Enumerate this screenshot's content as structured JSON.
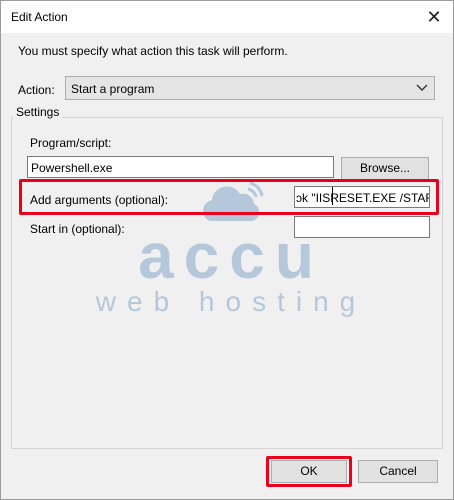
{
  "window": {
    "title": "Edit Action",
    "close_glyph": "✕"
  },
  "instruction": "You must specify what action this task will perform.",
  "action": {
    "label": "Action:",
    "selected": "Start a program"
  },
  "settings": {
    "legend": "Settings",
    "program_label": "Program/script:",
    "program_value": "Powershell.exe",
    "browse_label": "Browse...",
    "args_label": "Add arguments (optional):",
    "args_value": "ɔk \"IISRESET.EXE /START\"",
    "startin_label": "Start in (optional):",
    "startin_value": ""
  },
  "watermark": {
    "brand": "accu",
    "tagline": "web hosting"
  },
  "buttons": {
    "ok": "OK",
    "cancel": "Cancel"
  },
  "colors": {
    "highlight": "#e8001c",
    "watermark": "#1f62a8"
  }
}
